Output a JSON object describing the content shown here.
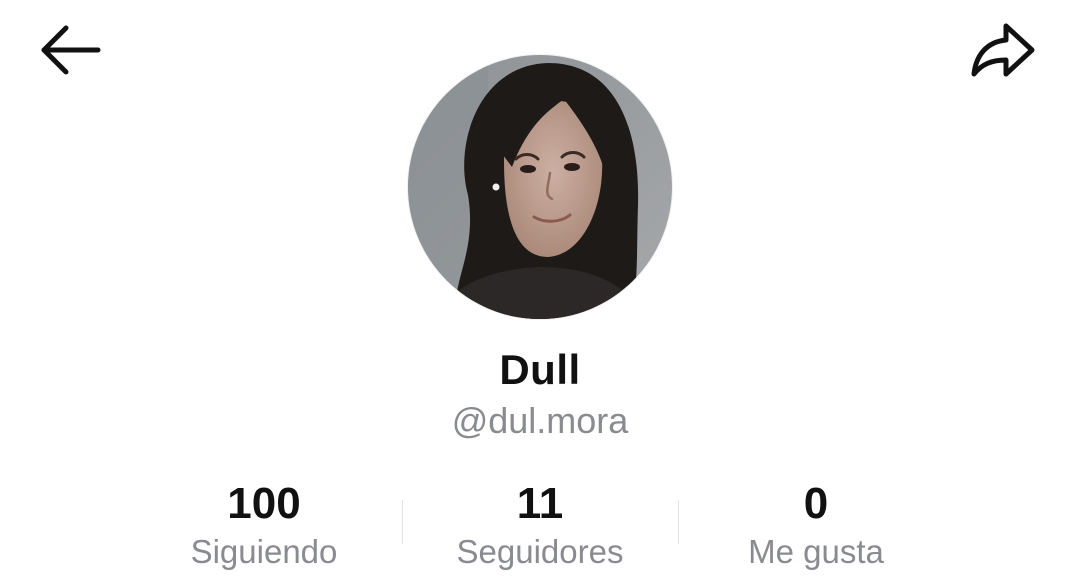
{
  "header": {
    "back_icon": "arrow-left-icon",
    "share_icon": "share-arrow-icon"
  },
  "profile": {
    "display_name": "Dull",
    "username": "@dul.mora",
    "avatar": "profile-photo"
  },
  "stats": [
    {
      "value": "100",
      "label": "Siguiendo"
    },
    {
      "value": "11",
      "label": "Seguidores"
    },
    {
      "value": "0",
      "label": "Me gusta"
    }
  ],
  "colors": {
    "text_primary": "#111111",
    "text_secondary": "#8a8b91",
    "divider": "#e3e3e6",
    "background": "#ffffff"
  }
}
